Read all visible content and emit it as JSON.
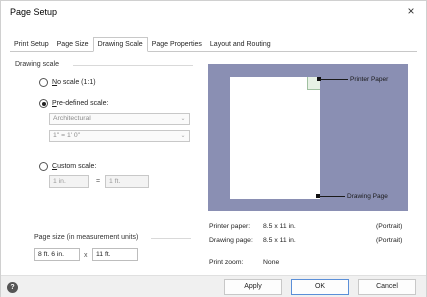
{
  "window": {
    "title": "Page Setup",
    "close_glyph": "×"
  },
  "tabs": [
    "Print Setup",
    "Page Size",
    "Drawing Scale",
    "Page Properties",
    "Layout and Routing"
  ],
  "active_tab": "Drawing Scale",
  "drawing_scale": {
    "section_label": "Drawing scale",
    "no_scale": {
      "prefix": "N",
      "rest": "o scale (1:1)",
      "selected": false
    },
    "predefined": {
      "prefix": "P",
      "rest": "re-defined scale:",
      "selected": true,
      "category_value": "Architectural",
      "scale_value": "1\" = 1' 0\""
    },
    "custom": {
      "prefix": "C",
      "rest": "ustom scale:",
      "selected": false,
      "left_value": "1 in.",
      "separator": "=",
      "right_value": "1 ft."
    }
  },
  "page_size": {
    "section_label": "Page size (in measurement units)",
    "width_value": "8 ft. 6 in.",
    "separator": "x",
    "height_value": "11 ft."
  },
  "preview": {
    "printer_paper_label": "Printer Paper",
    "drawing_page_label": "Drawing Page",
    "paper_color": "#ffffff",
    "background_color": "#8a8fb3"
  },
  "info": {
    "printer_paper": {
      "label": "Printer paper:",
      "value": "8.5 x 11 in.",
      "orientation": "(Portrait)"
    },
    "drawing_page": {
      "label": "Drawing page:",
      "value": "8.5 x 11 in.",
      "orientation": "(Portrait)"
    },
    "print_zoom": {
      "label": "Print zoom:",
      "value": "None"
    }
  },
  "footer": {
    "help_glyph": "?",
    "apply_label": "Apply",
    "ok_label": "OK",
    "cancel_label": "Cancel"
  },
  "colors": {
    "accent_border": "#5b8fd8"
  }
}
